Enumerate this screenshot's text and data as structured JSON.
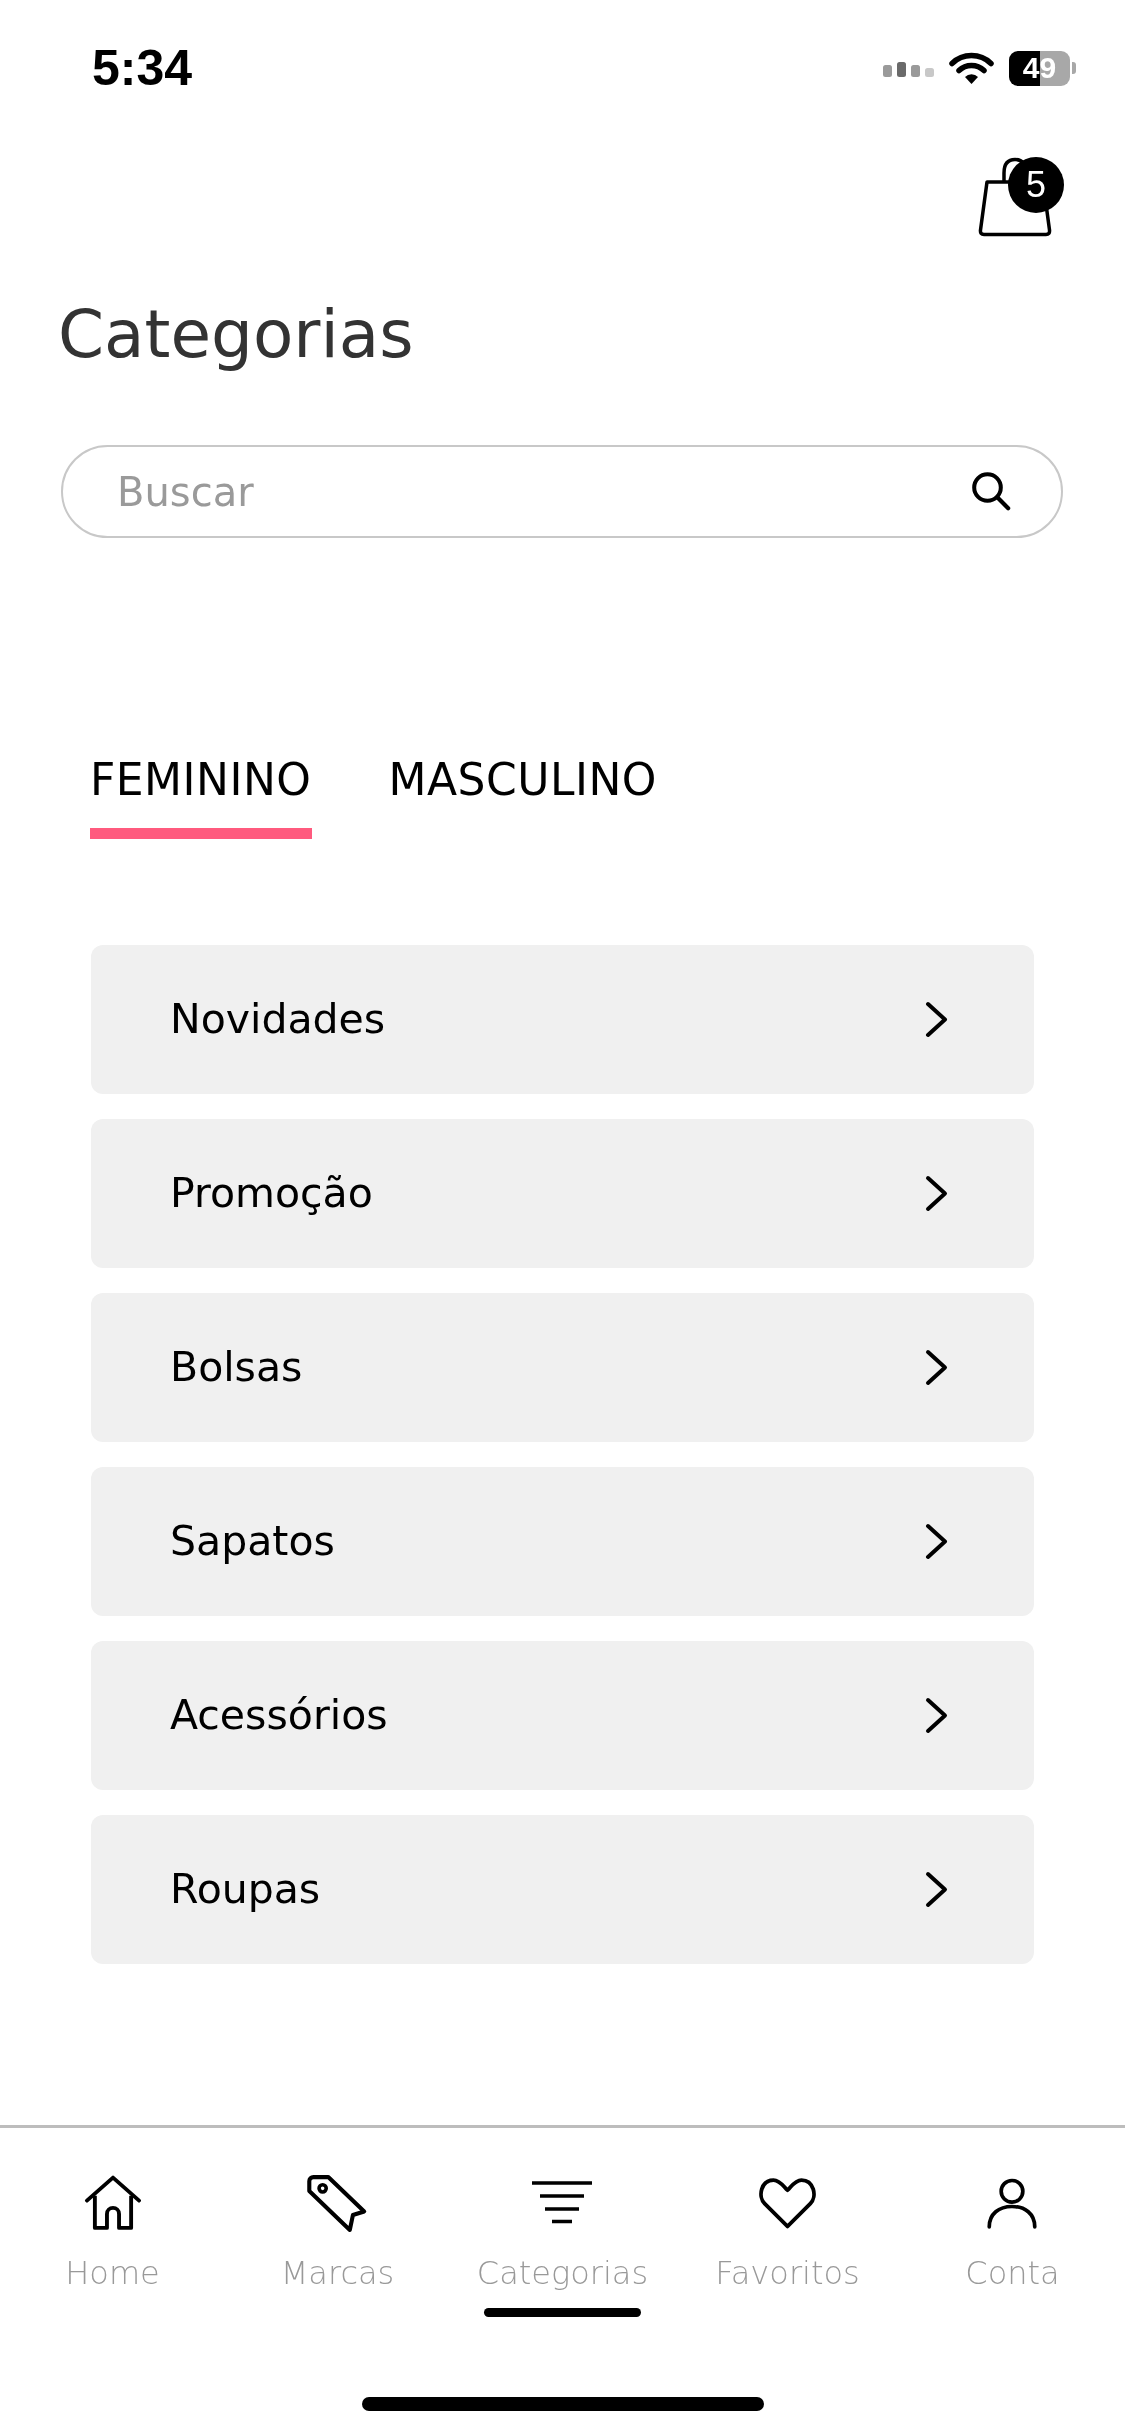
{
  "status_bar": {
    "time": "5:34",
    "battery": "49"
  },
  "header": {
    "cart_count": "5"
  },
  "title": "Categorias",
  "search": {
    "placeholder": "Buscar"
  },
  "tabs": [
    {
      "label": "FEMININO",
      "selected": true
    },
    {
      "label": "MASCULINO",
      "selected": false
    }
  ],
  "categories": [
    {
      "label": "Novidades"
    },
    {
      "label": "Promoção"
    },
    {
      "label": "Bolsas"
    },
    {
      "label": "Sapatos"
    },
    {
      "label": "Acessórios"
    },
    {
      "label": "Roupas"
    }
  ],
  "bottom_nav": [
    {
      "label": "Home",
      "selected": false
    },
    {
      "label": "Marcas",
      "selected": false
    },
    {
      "label": "Categorias",
      "selected": true
    },
    {
      "label": "Favoritos",
      "selected": false
    },
    {
      "label": "Conta",
      "selected": false
    }
  ]
}
